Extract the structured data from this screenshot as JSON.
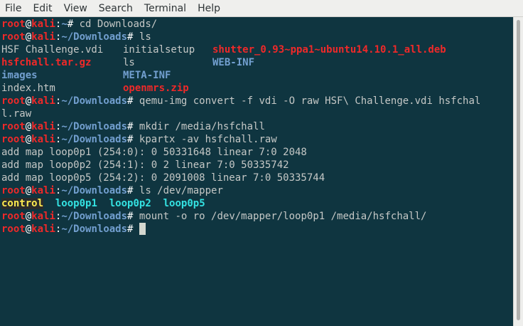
{
  "menu": [
    "File",
    "Edit",
    "View",
    "Search",
    "Terminal",
    "Help"
  ],
  "prompt": {
    "user": "root",
    "at": "@",
    "host": "kali",
    "colon": ":",
    "home": "~",
    "downloads": "~/Downloads",
    "end": "# "
  },
  "commands": {
    "c1": "cd Downloads/",
    "c2": "ls",
    "c3": "qemu-img convert -f vdi -O raw HSF\\ Challenge.vdi hsfchal",
    "c3b": "l.raw",
    "c4": "mkdir /media/hsfchall",
    "c5": "kpartx -av hsfchall.raw",
    "c6": "ls /dev/mapper",
    "c7": "mount -o ro /dev/mapper/loop0p1 /media/hsfchall/"
  },
  "ls_output": {
    "r1": [
      "HSF Challenge.vdi",
      "initialsetup",
      "shutter_0.93~ppa1~ubuntu14.10.1_all.deb"
    ],
    "r2": [
      "hsfchall.tar.gz",
      "ls",
      "WEB-INF"
    ],
    "r3": [
      "images",
      "META-INF"
    ],
    "r4": [
      "index.htm",
      "openmrs.zip"
    ]
  },
  "kpartx_output": [
    "add map loop0p1 (254:0): 0 50331648 linear 7:0 2048",
    "add map loop0p2 (254:1): 0 2 linear 7:0 50335742",
    "add map loop0p5 (254:2): 0 2091008 linear 7:0 50335744"
  ],
  "mapper_output": [
    "control",
    "loop0p1",
    "loop0p2",
    "loop0p5"
  ],
  "colors": {
    "background": "#0f3540",
    "prompt_user": "#ef2929",
    "prompt_path": "#729fcf",
    "archive": "#ef2929",
    "directory": "#729fcf",
    "device": "#34e2e2",
    "control": "#fce94f"
  }
}
